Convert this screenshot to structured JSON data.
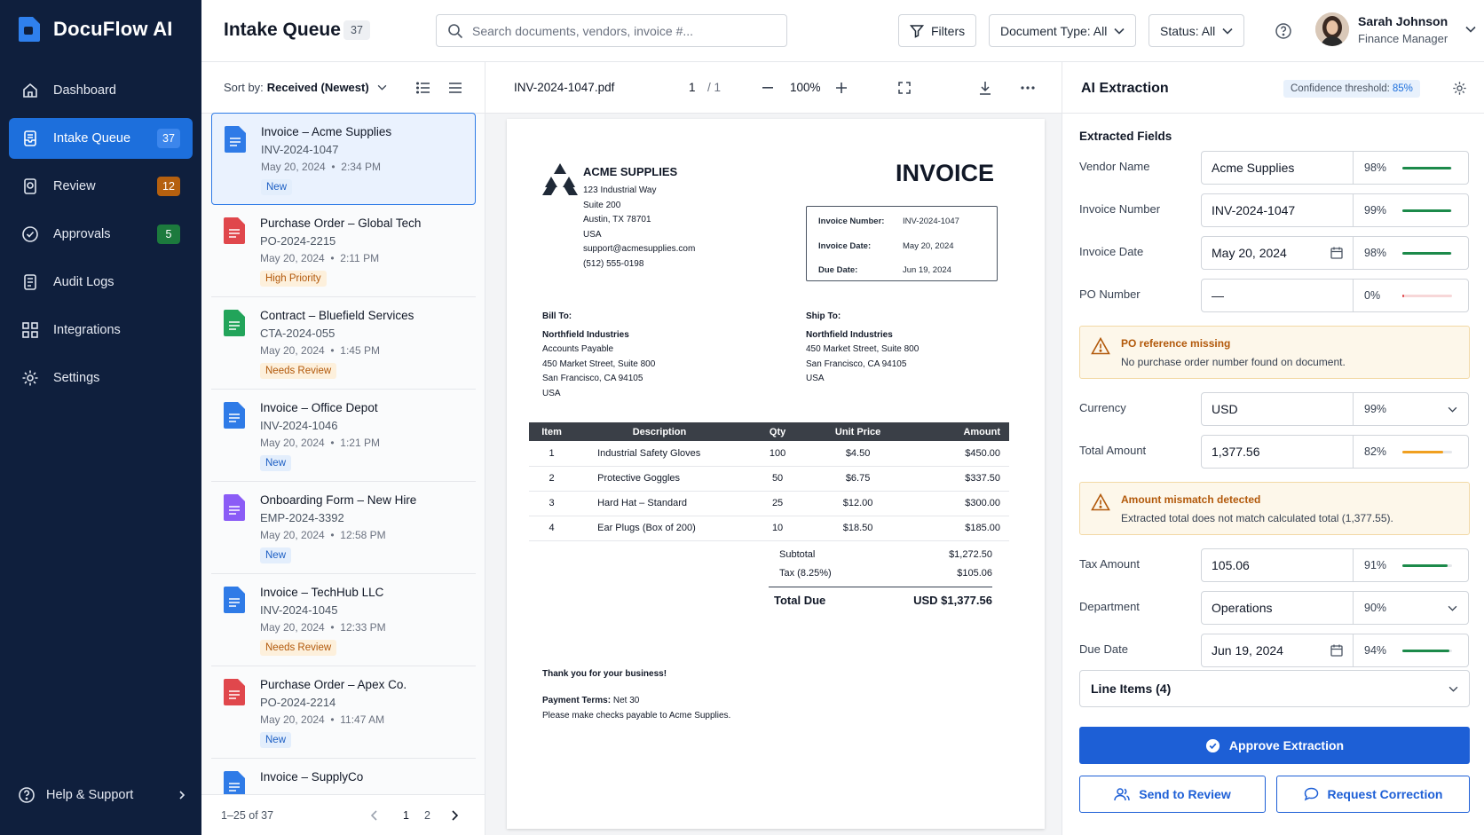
{
  "app": {
    "name": "DocuFlow AI"
  },
  "sidebar": {
    "items": [
      {
        "label": "Dashboard",
        "icon": "home-icon"
      },
      {
        "label": "Intake Queue",
        "icon": "inbox-icon",
        "badge": "37"
      },
      {
        "label": "Review",
        "icon": "review-icon",
        "badge": "12"
      },
      {
        "label": "Approvals",
        "icon": "check-circle-icon",
        "badge": "5"
      },
      {
        "label": "Audit Logs",
        "icon": "audit-log-icon"
      },
      {
        "label": "Integrations",
        "icon": "integrations-icon"
      },
      {
        "label": "Settings",
        "icon": "gear-icon"
      }
    ],
    "help": "Help & Support"
  },
  "header": {
    "title": "Intake Queue",
    "count": "37",
    "search_placeholder": "Search documents, vendors, invoice #...",
    "filters": "Filters",
    "doc_type": "Document Type: All",
    "status": "Status: All",
    "user": {
      "name": "Sarah Johnson",
      "role": "Finance Manager"
    }
  },
  "queue": {
    "sort_label": "Sort by:",
    "sort_value": "Received (Newest)",
    "items": [
      {
        "title": "Invoice – Acme Supplies",
        "id": "INV-2024-1047",
        "date": "May 20, 2024",
        "time": "2:34 PM",
        "tag": "New",
        "kind": "blue"
      },
      {
        "title": "Purchase Order – Global Tech",
        "id": "PO-2024-2215",
        "date": "May 20, 2024",
        "time": "2:11 PM",
        "tag": "High Priority",
        "kind": "red"
      },
      {
        "title": "Contract – Bluefield Services",
        "id": "CTA-2024-055",
        "date": "May 20, 2024",
        "time": "1:45 PM",
        "tag": "Needs Review",
        "kind": "green"
      },
      {
        "title": "Invoice – Office Depot",
        "id": "INV-2024-1046",
        "date": "May 20, 2024",
        "time": "1:21 PM",
        "tag": "New",
        "kind": "blue"
      },
      {
        "title": "Onboarding Form – New Hire",
        "id": "EMP-2024-3392",
        "date": "May 20, 2024",
        "time": "12:58 PM",
        "tag": "New",
        "kind": "purple"
      },
      {
        "title": "Invoice – TechHub LLC",
        "id": "INV-2024-1045",
        "date": "May 20, 2024",
        "time": "12:33 PM",
        "tag": "Needs Review",
        "kind": "blue"
      },
      {
        "title": "Purchase Order – Apex Co.",
        "id": "PO-2024-2214",
        "date": "May 20, 2024",
        "time": "11:47 AM",
        "tag": "New",
        "kind": "red"
      },
      {
        "title": "Invoice – SupplyCo",
        "kind": "blue"
      }
    ],
    "range": "1–25 of 37",
    "pages": [
      "1",
      "2"
    ]
  },
  "viewer": {
    "filename": "INV-2024-1047.pdf",
    "page": "1",
    "page_total": "/ 1",
    "zoom": "100%"
  },
  "invoice": {
    "vendor": "ACME SUPPLIES",
    "vendor_address": [
      "123 Industrial Way",
      "Suite 200",
      "Austin, TX 78701",
      "USA",
      "support@acmesupplies.com",
      "(512) 555-0198"
    ],
    "title": "INVOICE",
    "meta": [
      {
        "label": "Invoice Number:",
        "value": "INV-2024-1047"
      },
      {
        "label": "Invoice Date:",
        "value": "May 20, 2024"
      },
      {
        "label": "Due Date:",
        "value": "Jun 19, 2024"
      }
    ],
    "bill_to_label": "Bill To:",
    "bill_to": [
      "Northfield Industries",
      "Accounts Payable",
      "450 Market Street, Suite 800",
      "San Francisco, CA 94105",
      "USA"
    ],
    "ship_to_label": "Ship To:",
    "ship_to": [
      "Northfield Industries",
      "450 Market Street, Suite 800",
      "San Francisco, CA 94105",
      "USA"
    ],
    "columns": [
      "Item",
      "Description",
      "Qty",
      "Unit Price",
      "Amount"
    ],
    "rows": [
      [
        "1",
        "Industrial Safety Gloves",
        "100",
        "$4.50",
        "$450.00"
      ],
      [
        "2",
        "Protective Goggles",
        "50",
        "$6.75",
        "$337.50"
      ],
      [
        "3",
        "Hard Hat – Standard",
        "25",
        "$12.00",
        "$300.00"
      ],
      [
        "4",
        "Ear Plugs (Box of 200)",
        "10",
        "$18.50",
        "$185.00"
      ]
    ],
    "subtotal_label": "Subtotal",
    "subtotal": "$1,272.50",
    "tax_label": "Tax (8.25%)",
    "tax": "$105.06",
    "total_label": "Total Due",
    "total": "USD $1,377.56",
    "thanks": "Thank you for your business!",
    "terms_label": "Payment Terms:",
    "terms_value": "Net 30",
    "terms_note": "Please make checks payable to Acme Supplies."
  },
  "ai": {
    "title": "AI Extraction",
    "threshold_label": "Confidence threshold:",
    "threshold_value": "85%",
    "section": "Extracted Fields",
    "fields": [
      {
        "label": "Vendor Name",
        "value": "Acme Supplies",
        "confidence": "98%",
        "level": 0.98,
        "color": "#1c8a4a"
      },
      {
        "label": "Invoice Number",
        "value": "INV-2024-1047",
        "confidence": "99%",
        "level": 0.99,
        "color": "#1c8a4a"
      },
      {
        "label": "Invoice Date",
        "value": "May 20, 2024",
        "confidence": "98%",
        "level": 0.98,
        "color": "#1c8a4a",
        "control": "calendar"
      },
      {
        "label": "PO Number",
        "value": "—",
        "confidence": "0%",
        "level": 0.03,
        "color": "#e0474c"
      },
      {
        "label": "Currency",
        "value": "USD",
        "confidence": "99%",
        "control": "dropdown"
      },
      {
        "label": "Total Amount",
        "value": "1,377.56",
        "confidence": "82%",
        "level": 0.82,
        "color": "#f0a020"
      },
      {
        "label": "Tax Amount",
        "value": "105.06",
        "confidence": "91%",
        "level": 0.91,
        "color": "#1c8a4a"
      },
      {
        "label": "Department",
        "value": "Operations",
        "confidence": "90%",
        "control": "dropdown"
      },
      {
        "label": "Due Date",
        "value": "Jun 19, 2024",
        "confidence": "94%",
        "level": 0.94,
        "color": "#1c8a4a",
        "control": "calendar"
      }
    ],
    "alerts": [
      {
        "title": "PO reference missing",
        "message": "No purchase order number found on document."
      },
      {
        "title": "Amount mismatch detected",
        "message": "Extracted total does not match calculated total (1,377.55)."
      }
    ],
    "line_items": "Line Items (4)",
    "approve": "Approve Extraction",
    "send_review": "Send to Review",
    "request_correction": "Request Correction"
  }
}
